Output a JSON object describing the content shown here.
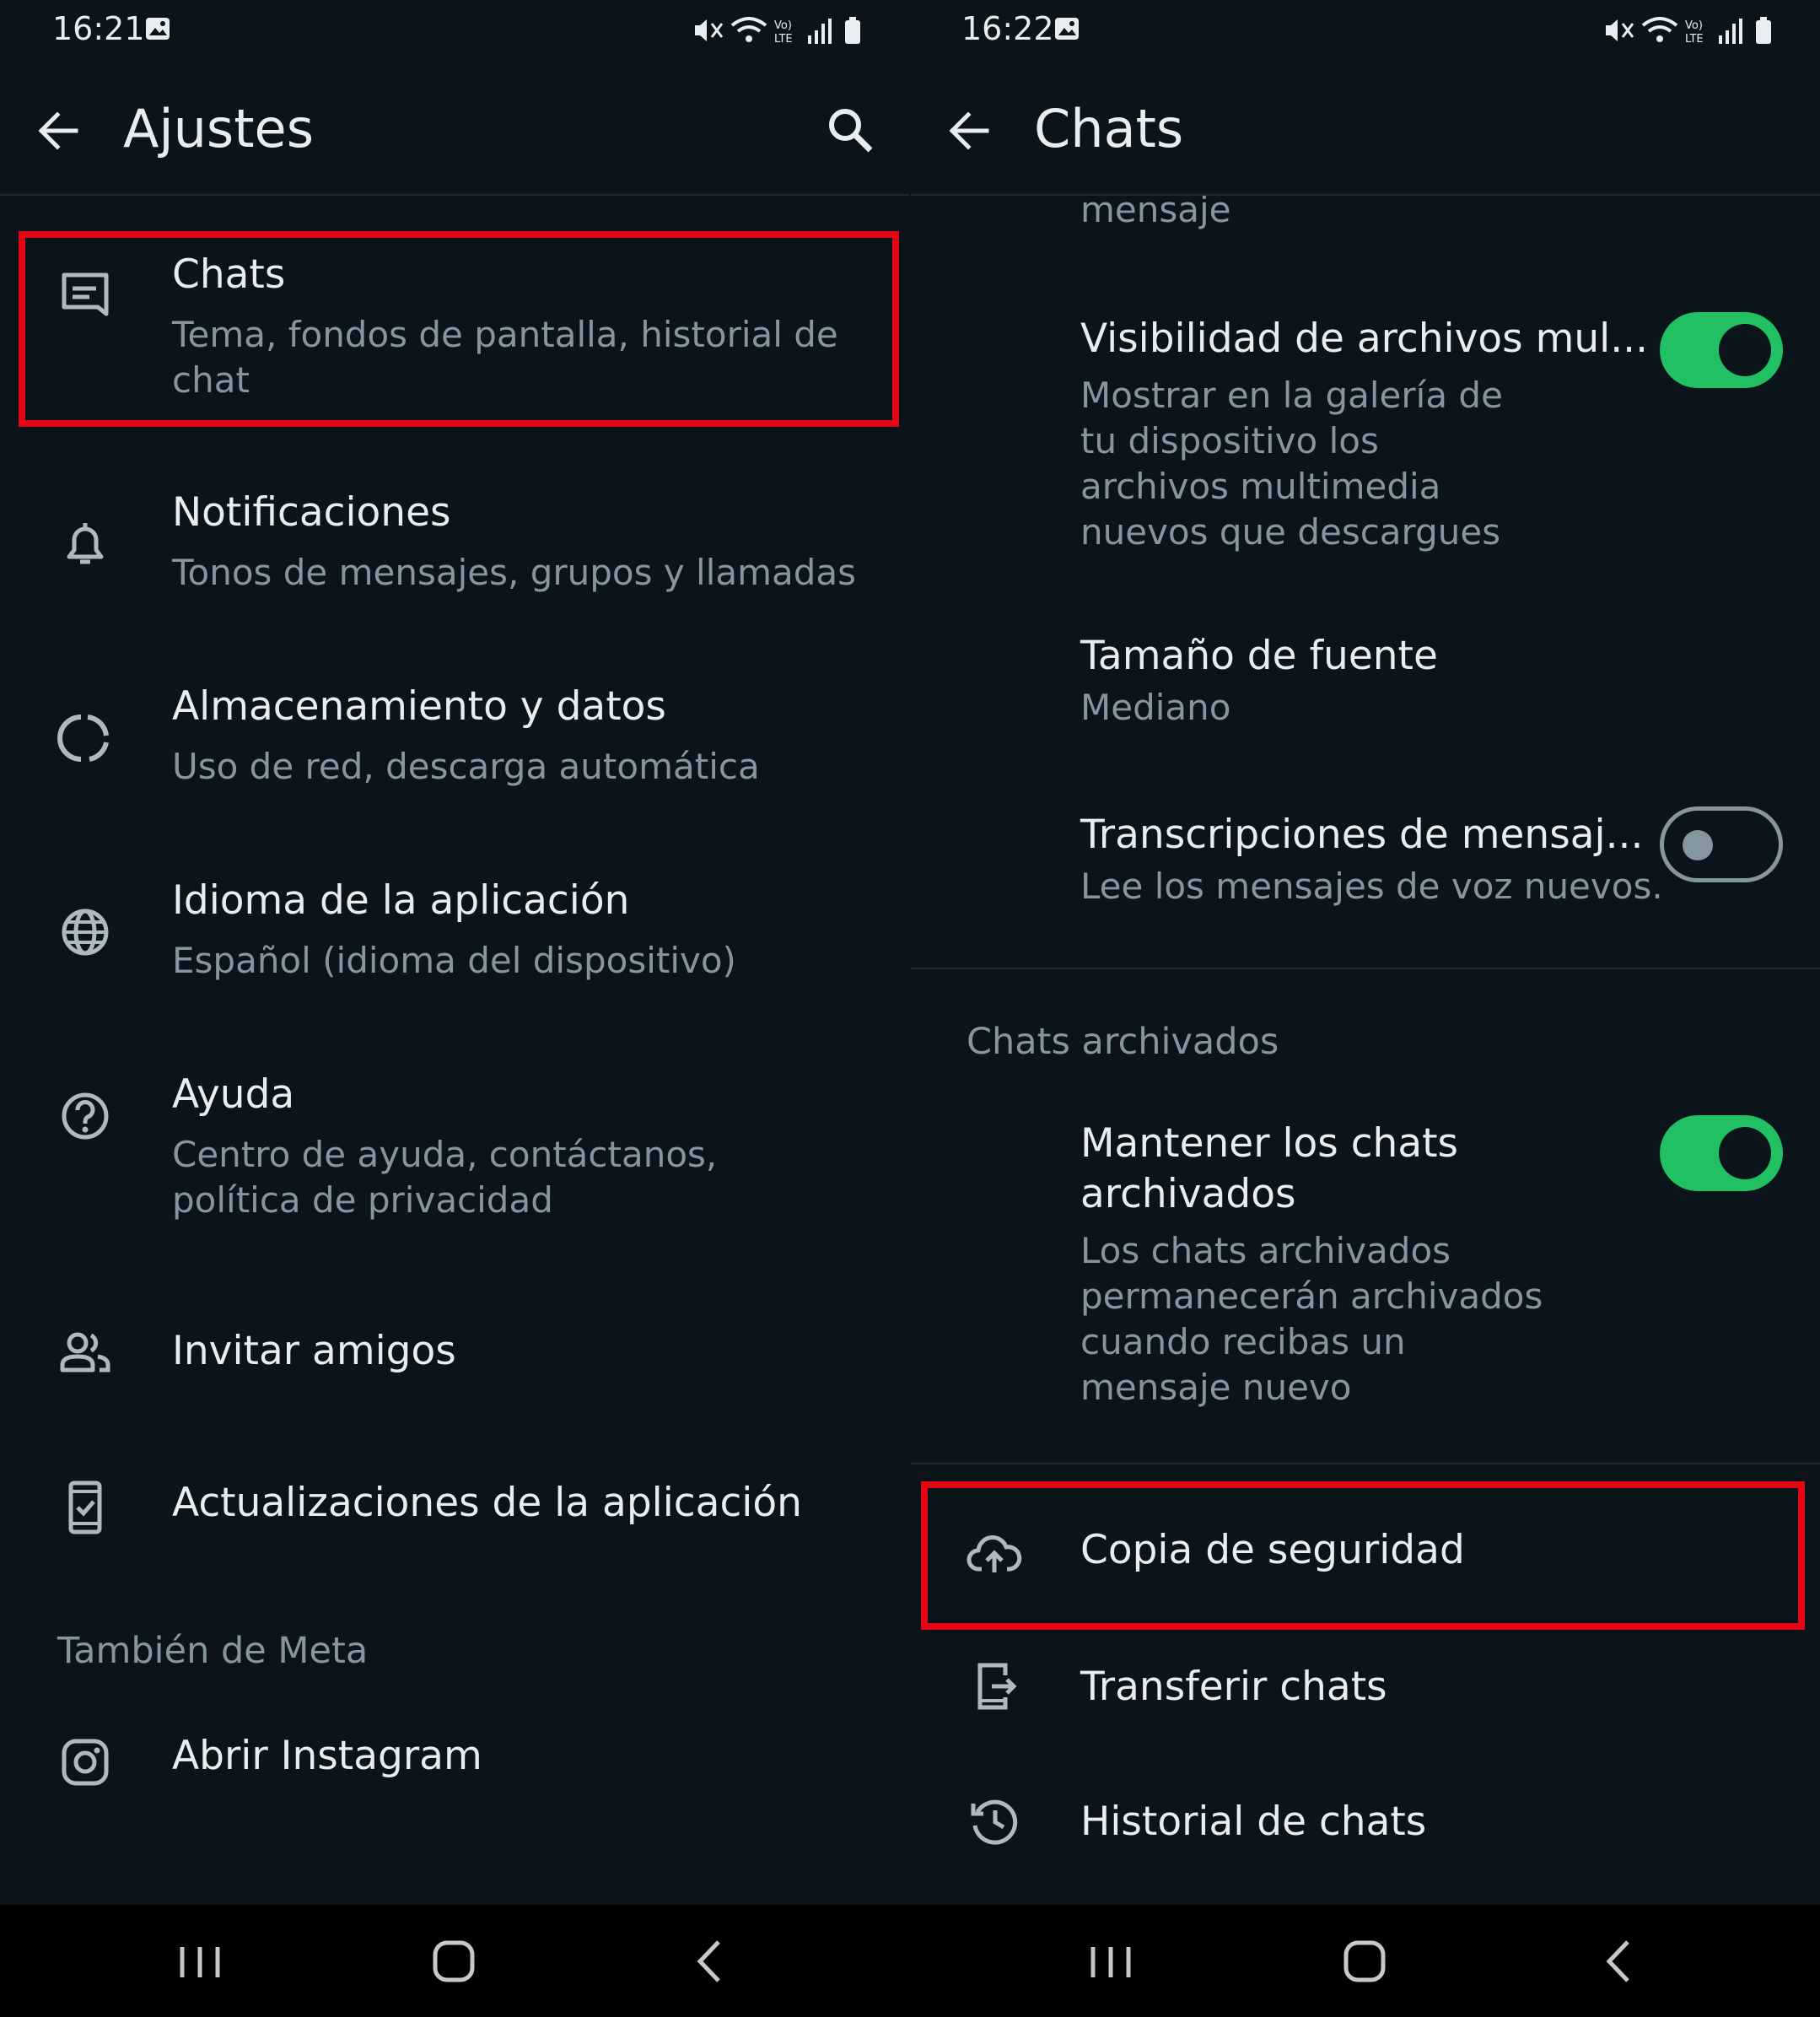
{
  "left": {
    "status_time": "16:21",
    "title": "Ajustes",
    "items": [
      {
        "title": "Chats",
        "subtitle": "Tema, fondos de pantalla, historial de chat"
      },
      {
        "title": "Notificaciones",
        "subtitle": "Tonos de mensajes, grupos y llamadas"
      },
      {
        "title": "Almacenamiento y datos",
        "subtitle": "Uso de red, descarga automática"
      },
      {
        "title": "Idioma de la aplicación",
        "subtitle": "Español (idioma del dispositivo)"
      },
      {
        "title": "Ayuda",
        "subtitle": "Centro de ayuda, contáctanos, política de privacidad"
      },
      {
        "title": "Invitar amigos"
      },
      {
        "title": "Actualizaciones de la aplicación"
      }
    ],
    "section_meta": "También de Meta",
    "instagram": "Abrir Instagram"
  },
  "right": {
    "status_time": "16:22",
    "title": "Chats",
    "partial_text": "mensaje",
    "media_visibility": {
      "title": "Visibilidad de archivos mul...",
      "subtitle": "Mostrar en la galería de tu dispositivo los archivos multimedia nuevos que descargues",
      "enabled": true
    },
    "font_size": {
      "title": "Tamaño de fuente",
      "value": "Mediano"
    },
    "transcriptions": {
      "title": "Transcripciones de mensaj...",
      "subtitle": "Lee los mensajes de voz nuevos.",
      "enabled": false
    },
    "section_archived": "Chats archivados",
    "keep_archived": {
      "title": "Mantener los chats archivados",
      "subtitle": "Los chats archivados permanecerán archivados cuando recibas un mensaje nuevo",
      "enabled": true
    },
    "backup": "Copia de seguridad",
    "transfer": "Transferir chats",
    "history": "Historial de chats"
  },
  "icons": [
    "back-arrow-icon",
    "search-icon",
    "chat-icon",
    "bell-icon",
    "storage-icon",
    "globe-icon",
    "help-icon",
    "people-icon",
    "phone-update-icon",
    "instagram-icon",
    "cloud-upload-icon",
    "transfer-icon",
    "history-icon"
  ],
  "colors": {
    "background": "#0b141b",
    "accent_green": "#21c063",
    "highlight_red": "#e30613",
    "secondary_text": "#8696a0"
  }
}
